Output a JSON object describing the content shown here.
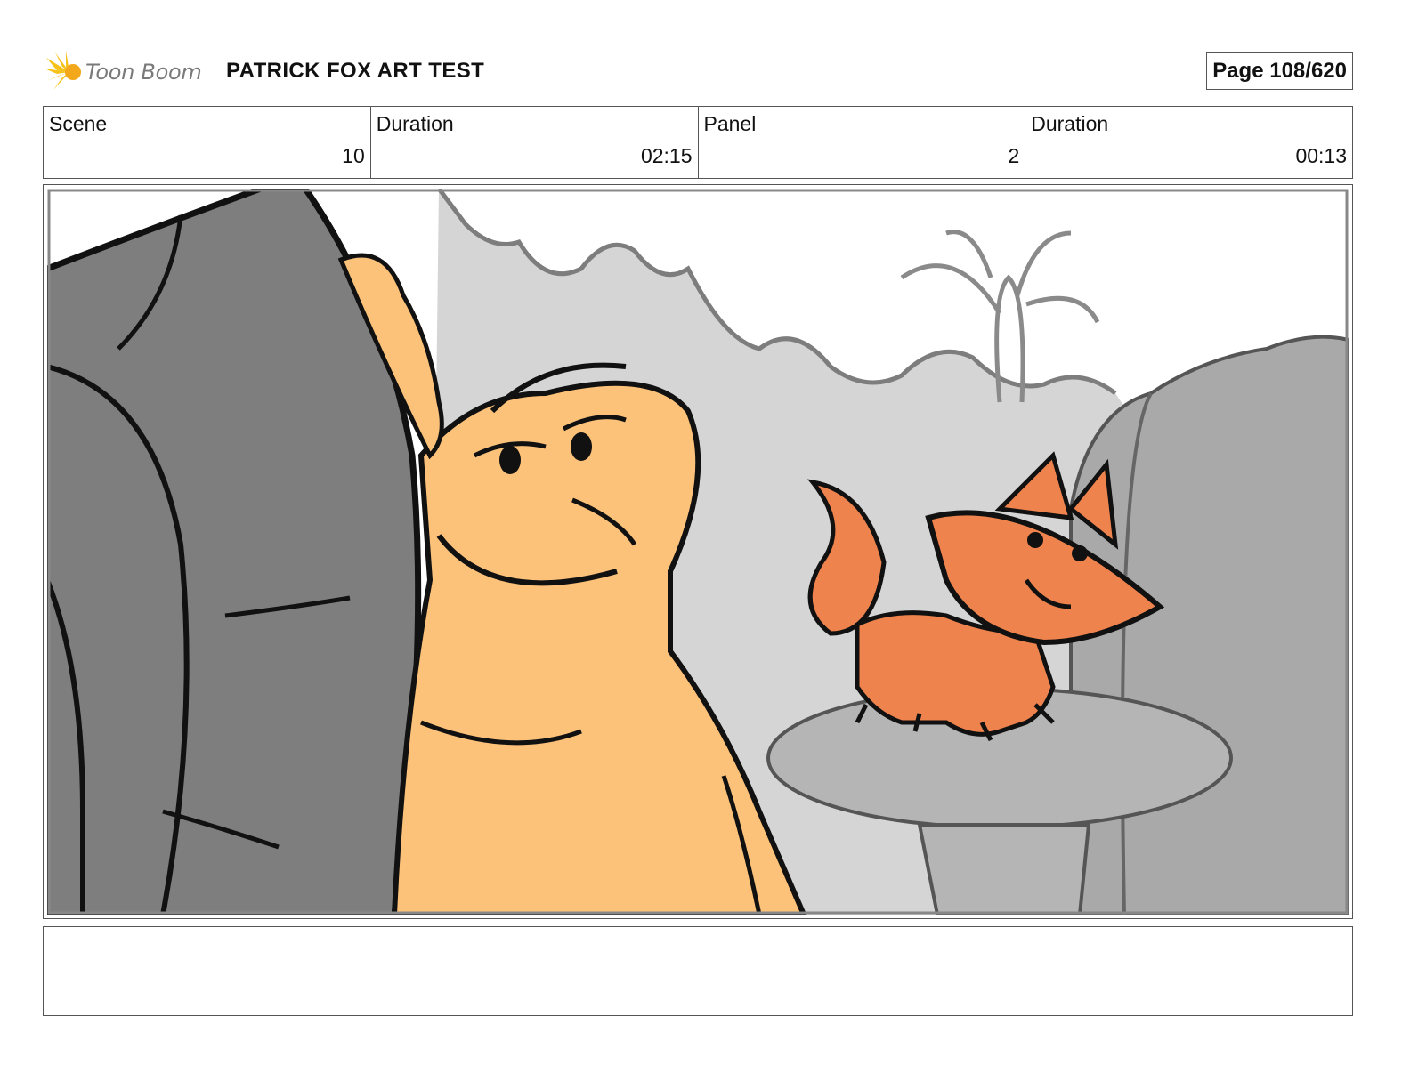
{
  "header": {
    "logo_text": "Toon Boom",
    "title": "PATRICK FOX ART TEST",
    "page_label": "Page 108/620"
  },
  "info": [
    {
      "label": "Scene",
      "value": "10"
    },
    {
      "label": "Duration",
      "value": "02:15"
    },
    {
      "label": "Panel",
      "value": "2"
    },
    {
      "label": "Duration",
      "value": "00:13"
    }
  ],
  "notes": {
    "text": ""
  },
  "colors": {
    "turtle_skin": "#FCC27A",
    "turtle_shell": "#7E7E7E",
    "fox": "#EE834E",
    "background": "#D3D3D3",
    "line": "#111111"
  }
}
